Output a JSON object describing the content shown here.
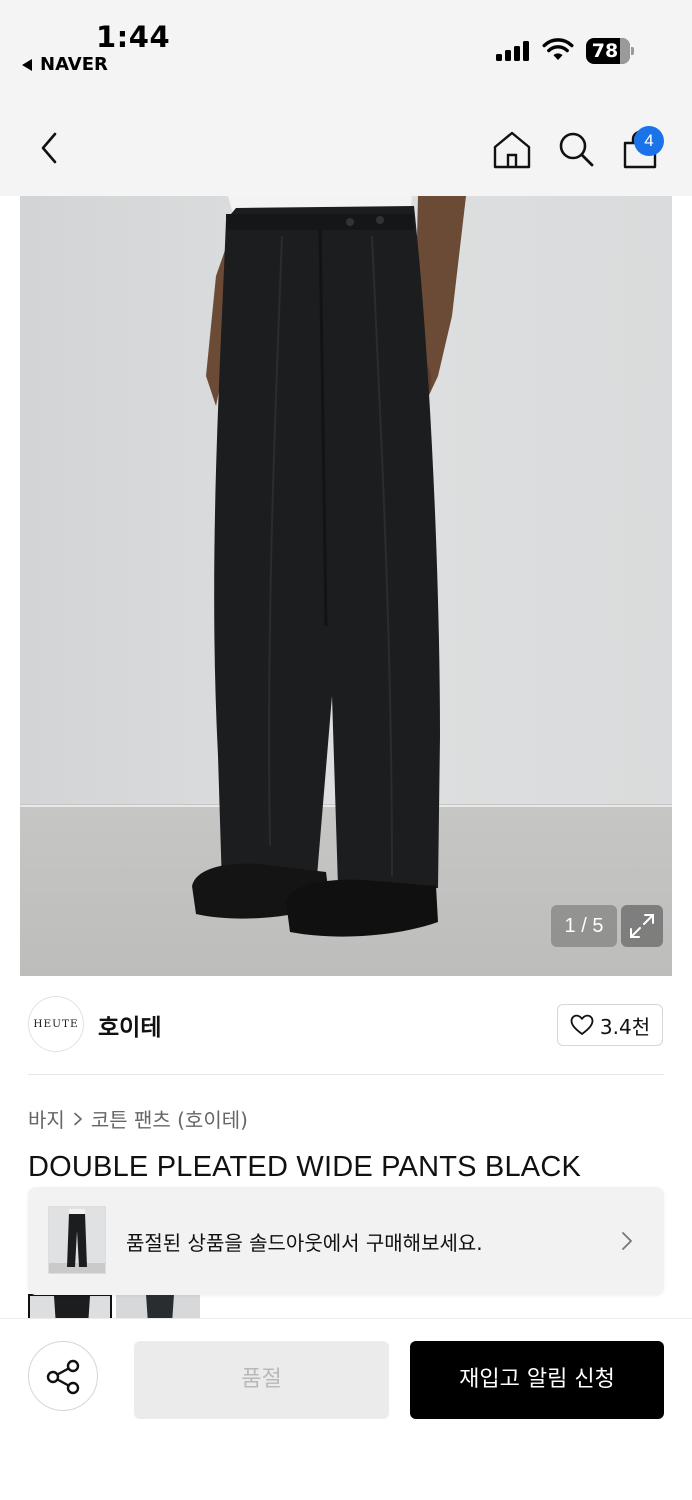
{
  "status_bar": {
    "time": "1:44",
    "back_app": "NAVER",
    "battery": "78",
    "battery_level": 0.78
  },
  "nav": {
    "cart_count": "4"
  },
  "product": {
    "image_counter": "1 / 5",
    "image_subject": "black double pleated wide pants on model",
    "brand_logo": "HEUTE",
    "brand_name": "호이테",
    "like_count": "3.4천",
    "breadcrumb": [
      "바지",
      "코튼 팬츠 (호이테)"
    ],
    "title": "DOUBLE PLEATED WIDE PANTS BLACK"
  },
  "soldout_banner": {
    "text": "품절된 상품을 솔드아웃에서 구매해보세요."
  },
  "bottom_bar": {
    "soldout_label": "품절",
    "restock_label": "재입고 알림 신청"
  },
  "colors": {
    "accent": "#1a73e8",
    "primary_button": "#000000",
    "disabled_button": "#ebebeb",
    "background": "#f4f4f4"
  },
  "icons": [
    "back-chevron-icon",
    "home-icon",
    "search-icon",
    "shopping-bag-icon",
    "expand-icon",
    "heart-icon",
    "chevron-right-icon",
    "share-icon"
  ]
}
